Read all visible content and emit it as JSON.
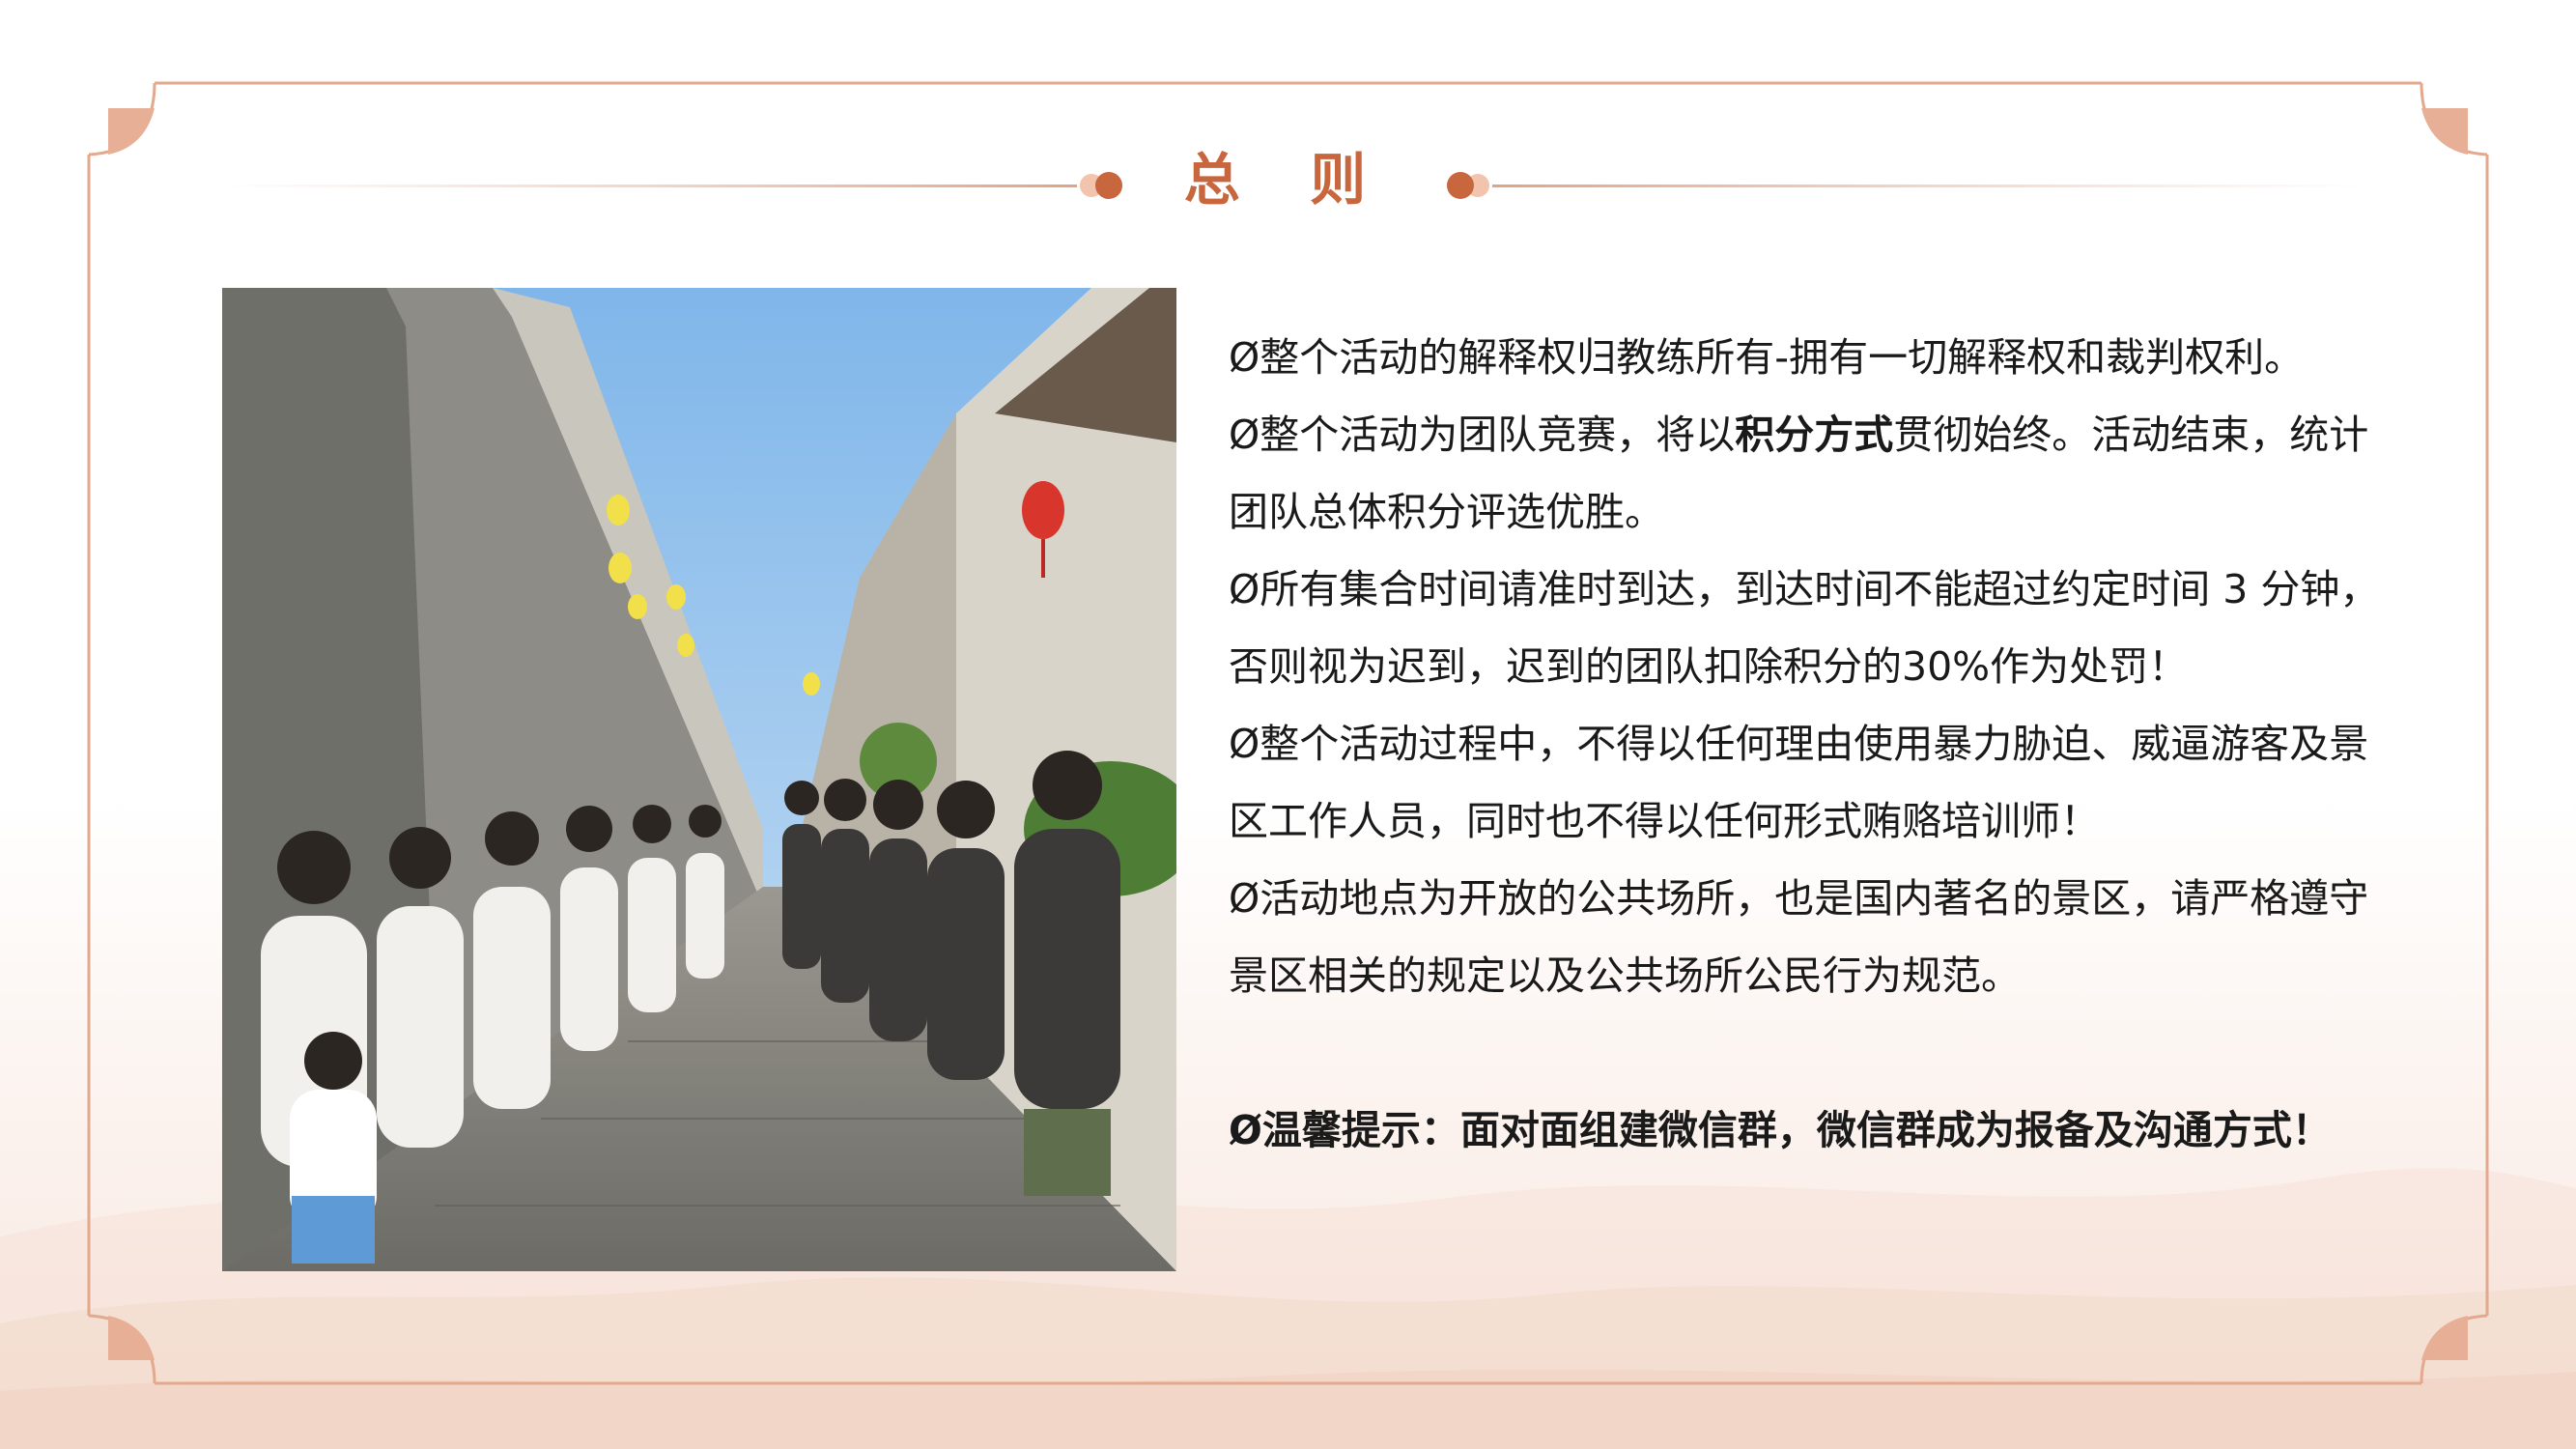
{
  "slide": {
    "title": "总 则",
    "colors": {
      "accent": "#c8663e",
      "frame_line": "#e2a98e",
      "text": "#1a1a1a"
    }
  },
  "photo": {
    "description_icon": "group-photo-in-old-village-lane"
  },
  "rules": {
    "bullet": "Ø",
    "item1": "整个活动的解释权归教练所有-拥有一切解释权和裁判权利。",
    "item2_pre": "整个活动为团队竞赛，将以",
    "item2_bold": "积分方式",
    "item2_post": "贯彻始终。活动结束，统计团队总体积分评选优胜。",
    "item3": "所有集合时间请准时到达，到达时间不能超过约定时间 3 分钟，否则视为迟到，迟到的团队扣除积分的30%作为处罚！",
    "item4": "整个活动过程中，不得以任何理由使用暴力胁迫、威逼游客及景区工作人员，同时也不得以任何形式贿赂培训师！",
    "item5": "活动地点为开放的公共场所，也是国内著名的景区，请严格遵守景区相关的规定以及公共场所公民行为规范。",
    "tip": "温馨提示：面对面组建微信群，微信群成为报备及沟通方式！"
  }
}
